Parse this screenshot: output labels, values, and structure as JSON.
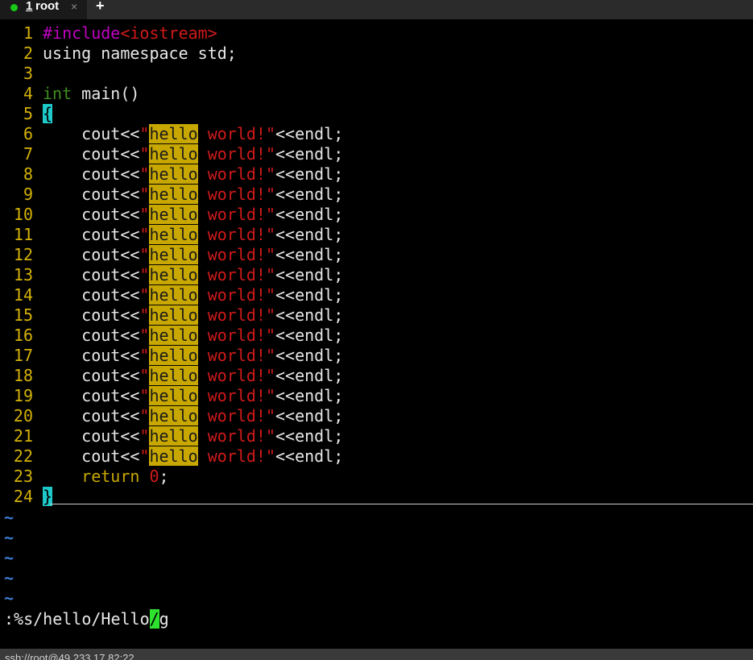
{
  "tab": {
    "number": "1",
    "name": "root",
    "close_icon": "×",
    "add_icon": "+",
    "status_dot_color": "#18c818"
  },
  "editor": {
    "lines": [
      {
        "n": "1",
        "pp": "#include",
        "str": "<iostream>"
      },
      {
        "n": "2",
        "text": "using namespace std;"
      },
      {
        "n": "3"
      },
      {
        "n": "4",
        "kw": "int",
        "text": " main()"
      },
      {
        "n": "5",
        "cursor_char": "{"
      },
      {
        "n": "6",
        "pre": "    cout<<",
        "q1": "\"",
        "hl": "hello",
        "str": " world!\"",
        "post": "<<endl;"
      },
      {
        "n": "7",
        "pre": "    cout<<",
        "q1": "\"",
        "hl": "hello",
        "str": " world!\"",
        "post": "<<endl;"
      },
      {
        "n": "8",
        "pre": "    cout<<",
        "q1": "\"",
        "hl": "hello",
        "str": " world!\"",
        "post": "<<endl;"
      },
      {
        "n": "9",
        "pre": "    cout<<",
        "q1": "\"",
        "hl": "hello",
        "str": " world!\"",
        "post": "<<endl;"
      },
      {
        "n": "10",
        "pre": "    cout<<",
        "q1": "\"",
        "hl": "hello",
        "str": " world!\"",
        "post": "<<endl;"
      },
      {
        "n": "11",
        "pre": "    cout<<",
        "q1": "\"",
        "hl": "hello",
        "str": " world!\"",
        "post": "<<endl;"
      },
      {
        "n": "12",
        "pre": "    cout<<",
        "q1": "\"",
        "hl": "hello",
        "str": " world!\"",
        "post": "<<endl;"
      },
      {
        "n": "13",
        "pre": "    cout<<",
        "q1": "\"",
        "hl": "hello",
        "str": " world!\"",
        "post": "<<endl;"
      },
      {
        "n": "14",
        "pre": "    cout<<",
        "q1": "\"",
        "hl": "hello",
        "str": " world!\"",
        "post": "<<endl;"
      },
      {
        "n": "15",
        "pre": "    cout<<",
        "q1": "\"",
        "hl": "hello",
        "str": " world!\"",
        "post": "<<endl;"
      },
      {
        "n": "16",
        "pre": "    cout<<",
        "q1": "\"",
        "hl": "hello",
        "str": " world!\"",
        "post": "<<endl;"
      },
      {
        "n": "17",
        "pre": "    cout<<",
        "q1": "\"",
        "hl": "hello",
        "str": " world!\"",
        "post": "<<endl;"
      },
      {
        "n": "18",
        "pre": "    cout<<",
        "q1": "\"",
        "hl": "hello",
        "str": " world!\"",
        "post": "<<endl;"
      },
      {
        "n": "19",
        "pre": "    cout<<",
        "q1": "\"",
        "hl": "hello",
        "str": " world!\"",
        "post": "<<endl;"
      },
      {
        "n": "20",
        "pre": "    cout<<",
        "q1": "\"",
        "hl": "hello",
        "str": " world!\"",
        "post": "<<endl;"
      },
      {
        "n": "21",
        "pre": "    cout<<",
        "q1": "\"",
        "hl": "hello",
        "str": " world!\"",
        "post": "<<endl;"
      },
      {
        "n": "22",
        "pre": "    cout<<",
        "q1": "\"",
        "hl": "hello",
        "str": " world!\"",
        "post": "<<endl;"
      },
      {
        "n": "23",
        "stmt": "    return",
        "sp": " ",
        "num": "0",
        "post": ";"
      },
      {
        "n": "24",
        "cursor_char": "}"
      }
    ],
    "tilde": "~",
    "tilde_count": 5
  },
  "command": {
    "before": ":%s/hello/Hello",
    "cursor_char": "/",
    "after": "g"
  },
  "status": {
    "text": "ssh://root@49.233.17.82:22"
  },
  "colors": {
    "line_number": "#d4b106",
    "preprocessor": "#c000c0",
    "keyword_type": "#3e8e1e",
    "statement": "#c8a800",
    "string": "#d11a1a",
    "search_highlight": "#c8a800",
    "cursor": "#1ec9c9",
    "cmd_cursor": "#2ee32e",
    "tilde": "#3c7cd1"
  }
}
